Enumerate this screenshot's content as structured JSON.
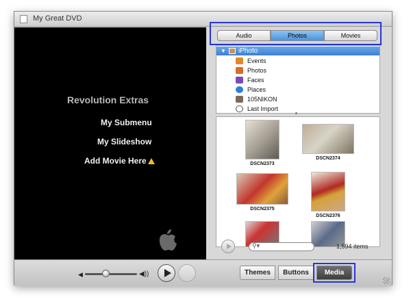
{
  "window": {
    "title": "My Great DVD"
  },
  "preview": {
    "menu_title": "Revolution Extras",
    "items": [
      "My Submenu",
      "My Slideshow",
      "Add Movie Here"
    ],
    "show_checkbox_checked": true
  },
  "playback": {
    "volume_percent": 40
  },
  "media_tabs": [
    {
      "label": "Audio",
      "selected": false
    },
    {
      "label": "Photos",
      "selected": true
    },
    {
      "label": "Movies",
      "selected": false
    }
  ],
  "source_list": {
    "header": "iPhoto",
    "items": [
      {
        "label": "Events",
        "icon": "events-icon",
        "color": "#e08a2a"
      },
      {
        "label": "Photos",
        "icon": "photos-icon",
        "color": "#d96b2b"
      },
      {
        "label": "Faces",
        "icon": "faces-icon",
        "color": "#7a4bb8"
      },
      {
        "label": "Places",
        "icon": "places-icon",
        "color": "#2f7fd6"
      },
      {
        "label": "105NIKON",
        "icon": "album-icon",
        "color": "#7b6a5a"
      },
      {
        "label": "Last Import",
        "icon": "clock-icon",
        "color": "#555555"
      }
    ]
  },
  "photos": [
    {
      "caption": "DSCN2373"
    },
    {
      "caption": "DSCN2374"
    },
    {
      "caption": "DSCN2375"
    },
    {
      "caption": "DSCN2376"
    },
    {
      "caption": ""
    },
    {
      "caption": ""
    }
  ],
  "media_footer": {
    "count": "1,594 items"
  },
  "bottom_buttons": {
    "themes": "Themes",
    "buttons": "Buttons",
    "media": "Media"
  },
  "colors": {
    "highlight": "#2535d8",
    "tab_selected": "#4a93dc"
  }
}
